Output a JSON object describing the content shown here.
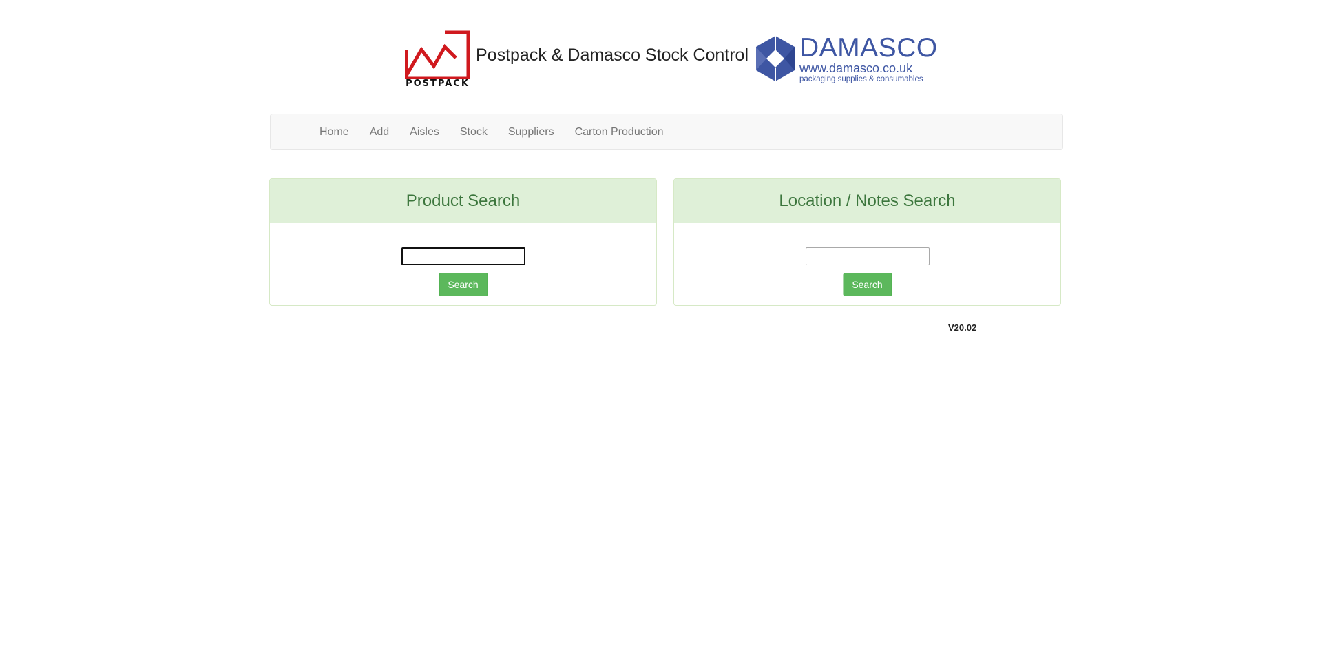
{
  "header": {
    "title": "Postpack & Damasco Stock Control",
    "postpack_logo_text": "POSTPACK",
    "damasco_name": "DAMASCO",
    "damasco_url": "www.damasco.co.uk",
    "damasco_tagline": "packaging supplies & consumables"
  },
  "nav": {
    "items": [
      {
        "label": "Home"
      },
      {
        "label": "Add"
      },
      {
        "label": "Aisles"
      },
      {
        "label": "Stock"
      },
      {
        "label": "Suppliers"
      },
      {
        "label": "Carton Production"
      }
    ]
  },
  "product_search": {
    "heading": "Product Search",
    "input_value": "",
    "button_label": "Search"
  },
  "location_search": {
    "heading": "Location / Notes Search",
    "input_value": "",
    "button_label": "Search"
  },
  "footer": {
    "version": "V20.02"
  },
  "colors": {
    "postpack_red": "#d0191e",
    "damasco_blue": "#3e56a3",
    "panel_heading_bg": "#dff0d8",
    "panel_heading_text": "#3c763d",
    "button_green": "#5cb85c"
  }
}
